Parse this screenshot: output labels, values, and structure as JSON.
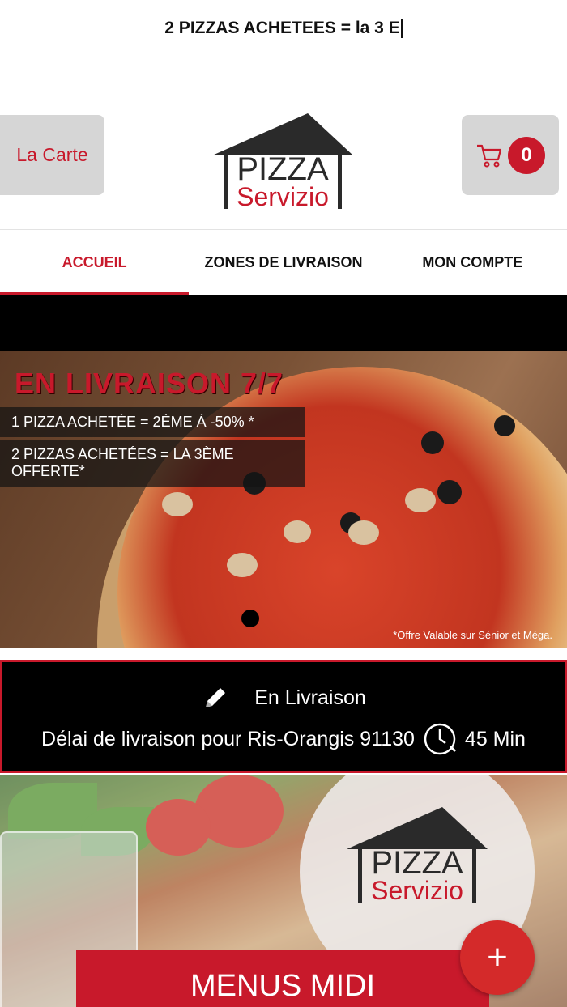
{
  "ticker": {
    "text": "2 PIZZAS ACHETEES = la 3 E"
  },
  "header": {
    "carte_label": "La Carte",
    "cart_count": "0",
    "logo": {
      "top": "PIZZA",
      "bottom": "Servizio"
    }
  },
  "nav": {
    "tabs": [
      {
        "label": "ACCUEIL",
        "active": true
      },
      {
        "label": "ZONES DE LIVRAISON",
        "active": false
      },
      {
        "label": "MON COMPTE",
        "active": false
      }
    ]
  },
  "banner": {
    "title": "EN LIVRAISON 7/7",
    "offer1": "1 PIZZA ACHETÉE = 2ÈME  À -50% *",
    "offer2": "2 PIZZAS ACHETÉES = LA 3ÈME OFFERTE*",
    "note": "*Offre Valable sur Sénior et Méga."
  },
  "delivery": {
    "mode": "En Livraison",
    "delay_text": "Délai de livraison pour Ris-Orangis 91130",
    "duration": "45 Min"
  },
  "promo": {
    "logo": {
      "top": "PIZZA",
      "bottom": "Servizio"
    },
    "button_label": "MENUS MIDI",
    "fab_symbol": "+"
  },
  "colors": {
    "accent": "#c8192b",
    "dark": "#000000",
    "grey_button": "#d6d6d6"
  }
}
